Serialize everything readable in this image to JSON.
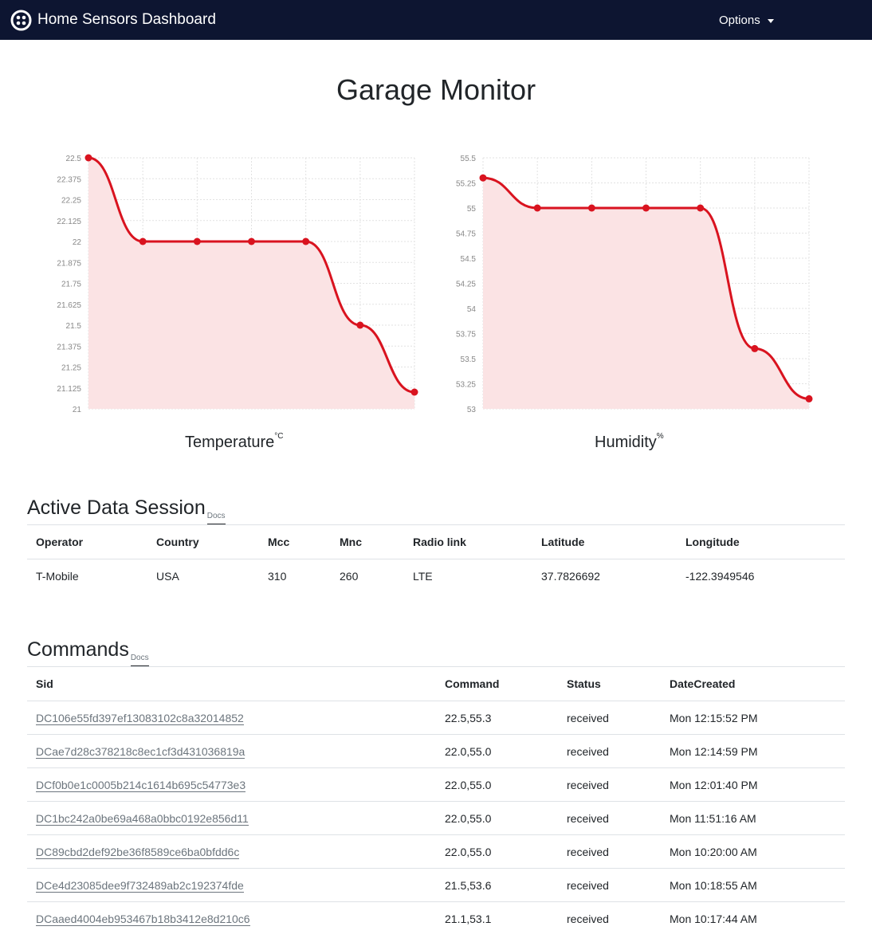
{
  "navbar": {
    "title": "Home Sensors Dashboard",
    "options_label": "Options",
    "background": "#0d1531",
    "logo_icon": "twilio-logo-icon"
  },
  "page": {
    "title": "Garage Monitor"
  },
  "chart_data": [
    {
      "type": "area",
      "title": "Temperature",
      "unit": "°C",
      "x": [
        1,
        2,
        3,
        4,
        5,
        6,
        7
      ],
      "values": [
        22.5,
        22.0,
        22.0,
        22.0,
        22.0,
        21.5,
        21.1
      ],
      "ylim": [
        21,
        22.5
      ],
      "yticks": [
        "22.5",
        "22.375",
        "22.25",
        "22.125",
        "22",
        "21.875",
        "21.75",
        "21.625",
        "21.5",
        "21.375",
        "21.25",
        "21.125",
        "21"
      ],
      "grid": true,
      "line_color": "#d9131f",
      "fill_color": "#fbe3e4"
    },
    {
      "type": "area",
      "title": "Humidity",
      "unit": "%",
      "x": [
        1,
        2,
        3,
        4,
        5,
        6,
        7
      ],
      "values": [
        55.3,
        55.0,
        55.0,
        55.0,
        55.0,
        53.6,
        53.1
      ],
      "ylim": [
        53,
        55.5
      ],
      "yticks": [
        "55.5",
        "55.25",
        "55",
        "54.75",
        "54.5",
        "54.25",
        "54",
        "53.75",
        "53.5",
        "53.25",
        "53"
      ],
      "grid": true,
      "line_color": "#d9131f",
      "fill_color": "#fbe3e4"
    }
  ],
  "session": {
    "heading": "Active Data Session",
    "docs_label": "Docs",
    "columns": [
      "Operator",
      "Country",
      "Mcc",
      "Mnc",
      "Radio link",
      "Latitude",
      "Longitude"
    ],
    "row": [
      "T-Mobile",
      "USA",
      "310",
      "260",
      "LTE",
      "37.7826692",
      "-122.3949546"
    ]
  },
  "commands": {
    "heading": "Commands",
    "docs_label": "Docs",
    "columns": [
      "Sid",
      "Command",
      "Status",
      "DateCreated"
    ],
    "rows": [
      {
        "sid": "DC106e55fd397ef13083102c8a32014852",
        "command": "22.5,55.3",
        "status": "received",
        "date": "Mon 12:15:52 PM"
      },
      {
        "sid": "DCae7d28c378218c8ec1cf3d431036819a",
        "command": "22.0,55.0",
        "status": "received",
        "date": "Mon 12:14:59 PM"
      },
      {
        "sid": "DCf0b0e1c0005b214c1614b695c54773e3",
        "command": "22.0,55.0",
        "status": "received",
        "date": "Mon 12:01:40 PM"
      },
      {
        "sid": "DC1bc242a0be69a468a0bbc0192e856d11",
        "command": "22.0,55.0",
        "status": "received",
        "date": "Mon 11:51:16 AM"
      },
      {
        "sid": "DC89cbd2def92be36f8589ce6ba0bfdd6c",
        "command": "22.0,55.0",
        "status": "received",
        "date": "Mon 10:20:00 AM"
      },
      {
        "sid": "DCe4d23085dee9f732489ab2c192374fde",
        "command": "21.5,53.6",
        "status": "received",
        "date": "Mon 10:18:55 AM"
      },
      {
        "sid": "DCaaed4004eb953467b18b3412e8d210c6",
        "command": "21.1,53.1",
        "status": "received",
        "date": "Mon 10:17:44 AM"
      }
    ]
  }
}
